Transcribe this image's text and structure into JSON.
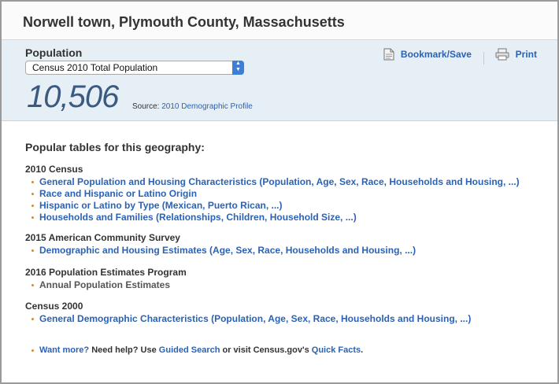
{
  "title": "Norwell town, Plymouth County, Massachusetts",
  "population": {
    "label": "Population",
    "select_value": "Census 2010 Total Population",
    "number": "10,506",
    "source_prefix": "Source:",
    "source_link": "2010 Demographic Profile"
  },
  "actions": {
    "bookmark": "Bookmark/Save",
    "print": "Print"
  },
  "popular": {
    "heading": "Popular tables for this geography:",
    "groups": [
      {
        "title": "2010 Census",
        "items": [
          "General Population and Housing Characteristics (Population, Age, Sex, Race, Households and Housing, ...)",
          "Race and Hispanic or Latino Origin",
          "Hispanic or Latino by Type (Mexican, Puerto Rican, ...)",
          "Households and Families (Relationships, Children, Household Size, ...)"
        ]
      },
      {
        "title": "2015 American Community Survey",
        "items": [
          "Demographic and Housing Estimates (Age, Sex, Race, Households and Housing, ...)"
        ]
      },
      {
        "title": "2016 Population Estimates Program",
        "items": [
          "Annual Population Estimates"
        ]
      },
      {
        "title": "Census 2000",
        "items": [
          "General Demographic Characteristics (Population, Age, Sex, Race, Households and Housing, ...)"
        ]
      }
    ]
  },
  "footer": {
    "want_more": "Want more?",
    "need_help": " Need help? Use ",
    "guided_search": "Guided Search",
    "or_visit": " or visit Census.gov's ",
    "quick_facts": "Quick Facts",
    "end": "."
  },
  "colors": {
    "link": "#2a62b5",
    "number": "#3a5a80",
    "panel": "#e6eef6",
    "bullet": "#d08a33"
  },
  "icons": [
    "document-icon",
    "printer-icon",
    "dropdown-arrow-icon"
  ]
}
